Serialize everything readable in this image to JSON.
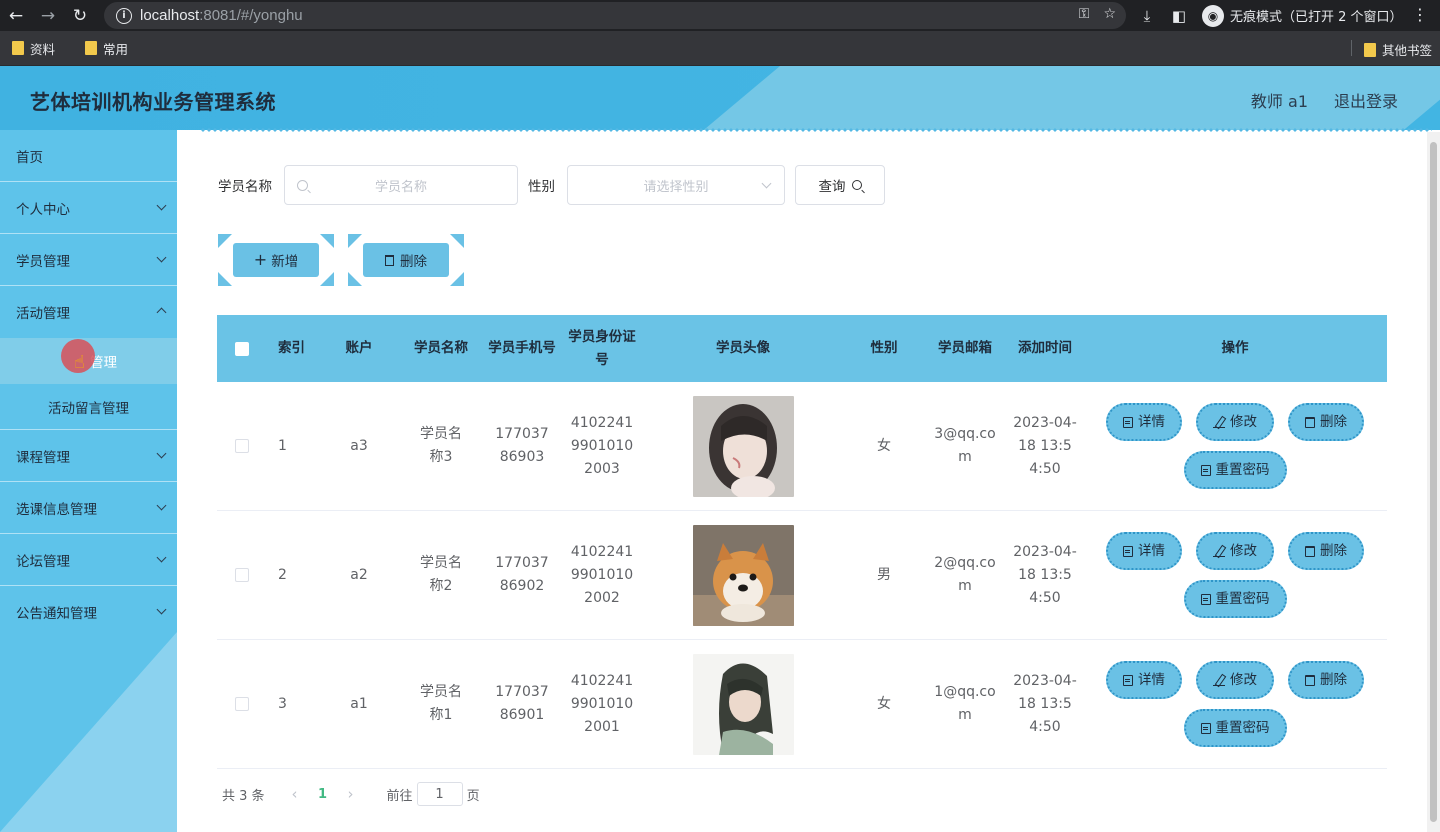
{
  "browser": {
    "url_host": "localhost",
    "url_rest": ":8081/#/yonghu",
    "incognito_label": "无痕模式（已打开 2 个窗口）",
    "bookmarks": [
      "资料",
      "常用"
    ],
    "other_bookmarks": "其他书签"
  },
  "header": {
    "title": "艺体培训机构业务管理系统",
    "user": "教师 a1",
    "logout": "退出登录"
  },
  "sidebar": {
    "items": [
      {
        "label": "首页"
      },
      {
        "label": "个人中心"
      },
      {
        "label": "学员管理"
      },
      {
        "label": "活动管理"
      },
      {
        "label": "课程管理"
      },
      {
        "label": "选课信息管理"
      },
      {
        "label": "论坛管理"
      },
      {
        "label": "公告通知管理"
      }
    ],
    "sub_items": [
      {
        "label": "管理"
      },
      {
        "label": "活动留言管理"
      }
    ]
  },
  "search": {
    "name_label": "学员名称",
    "name_placeholder": "学员名称",
    "sex_label": "性别",
    "sex_placeholder": "请选择性别",
    "query_button": "查询"
  },
  "actions": {
    "add": "新增",
    "delete": "删除"
  },
  "table": {
    "headers": [
      "索引",
      "账户",
      "学员名称",
      "学员手机号",
      "学员身份证号",
      "学员头像",
      "性别",
      "学员邮箱",
      "添加时间",
      "操作"
    ],
    "rows": [
      {
        "idx": "1",
        "account": "a3",
        "name": "学员名称3",
        "phone": "17703786903",
        "idcard": "410224199010102003",
        "avatar": "girl-portrait",
        "sex": "女",
        "email": "3@qq.com",
        "time": "2023-04-18 13:54:50"
      },
      {
        "idx": "2",
        "account": "a2",
        "name": "学员名称2",
        "phone": "17703786902",
        "idcard": "410224199010102002",
        "avatar": "shiba-dog",
        "sex": "男",
        "email": "2@qq.com",
        "time": "2023-04-18 13:54:50"
      },
      {
        "idx": "3",
        "account": "a1",
        "name": "学员名称1",
        "phone": "17703786901",
        "idcard": "410224199010102001",
        "avatar": "anime-girl",
        "sex": "女",
        "email": "1@qq.com",
        "time": "2023-04-18 13:54:50"
      }
    ],
    "ops": {
      "detail": "详情",
      "edit": "修改",
      "delete": "删除",
      "reset": "重置密码"
    }
  },
  "pager": {
    "total": "共 3 条",
    "current": "1",
    "goto_prefix": "前往",
    "goto_value": "1",
    "goto_suffix": "页"
  },
  "colors": {
    "header_bg": "#42b5e3",
    "sidebar_bg": "#5ec3ea",
    "table_head_bg": "#6ac3e6",
    "button_bg": "#6ac1e5"
  }
}
